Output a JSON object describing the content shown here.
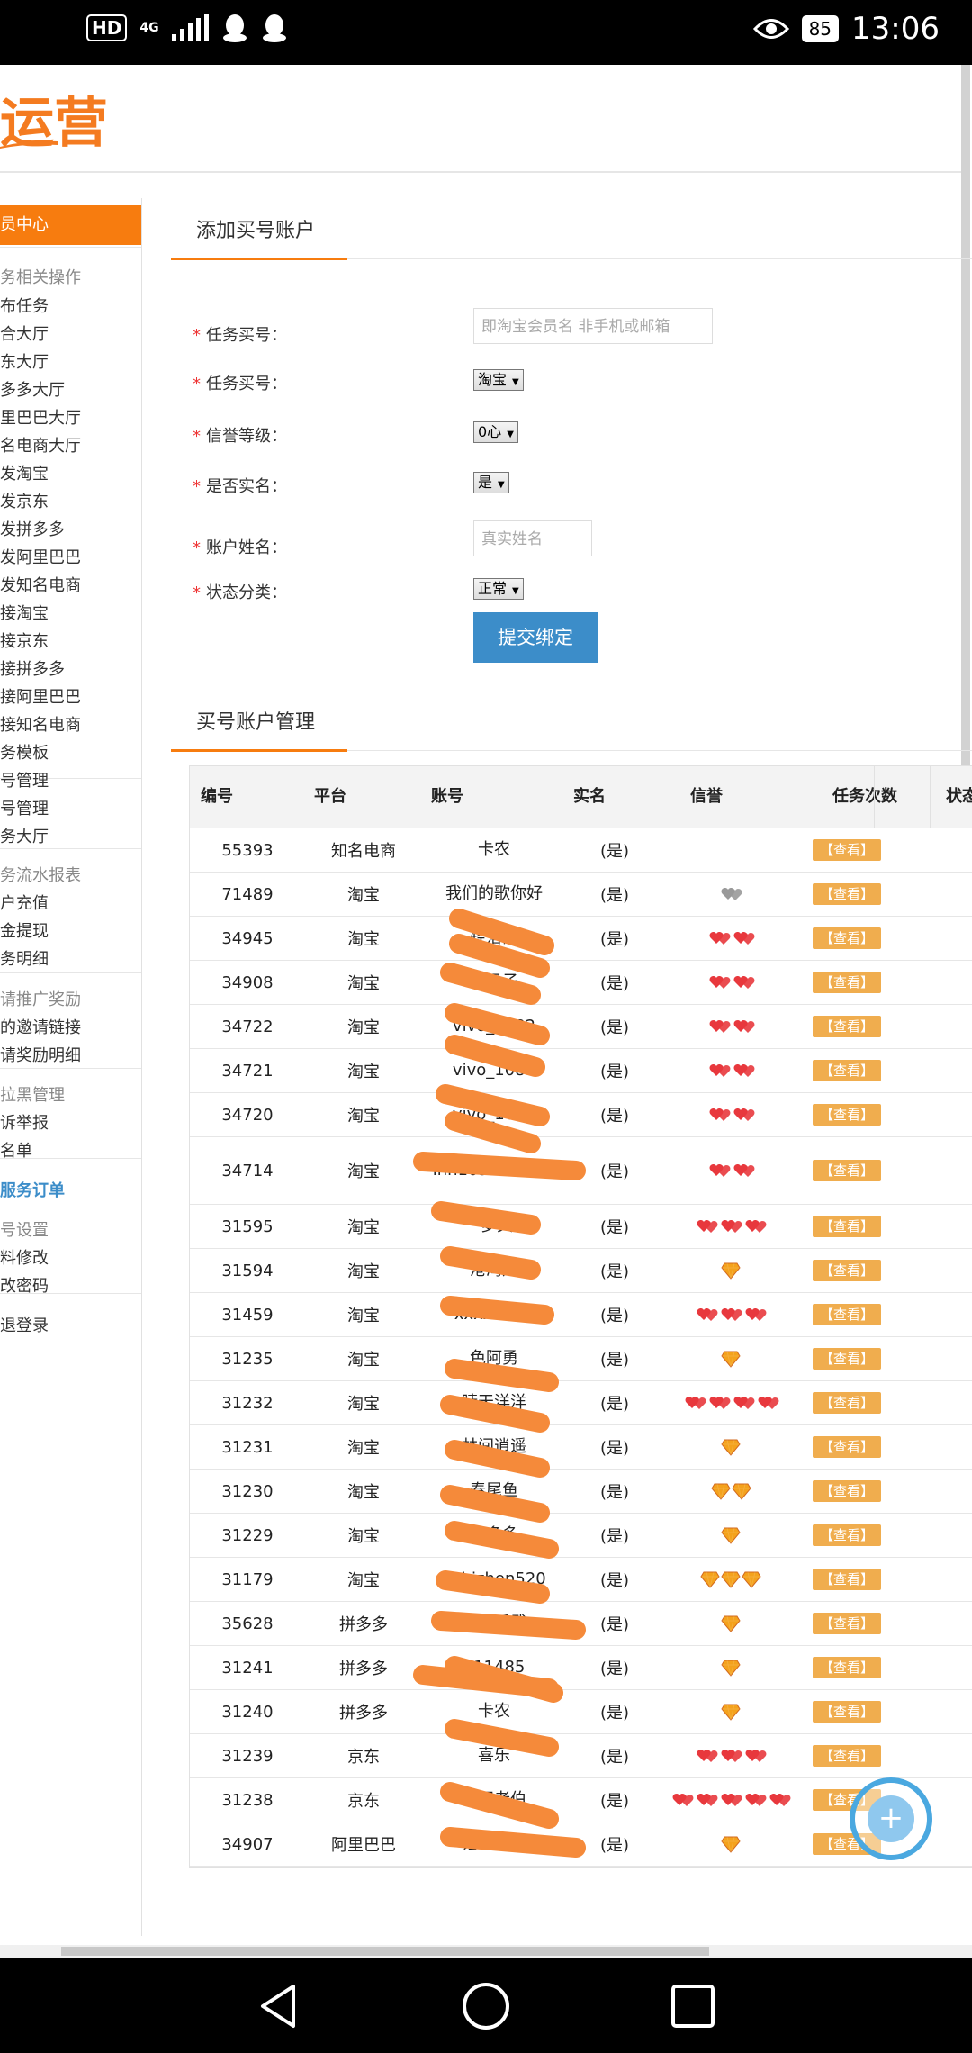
{
  "status_bar": {
    "hd": "HD",
    "network": "4G",
    "battery": "85",
    "time": "13:06"
  },
  "logo_text": "运营",
  "sidebar": {
    "active": "员中心",
    "sections": [
      {
        "type": "group",
        "label": "务相关操作"
      },
      {
        "type": "item",
        "label": "布任务"
      },
      {
        "type": "item",
        "label": "合大厅"
      },
      {
        "type": "item",
        "label": "东大厅"
      },
      {
        "type": "item",
        "label": "多多大厅"
      },
      {
        "type": "item",
        "label": "里巴巴大厅"
      },
      {
        "type": "item",
        "label": "名电商大厅"
      },
      {
        "type": "item",
        "label": "发淘宝"
      },
      {
        "type": "item",
        "label": "发京东"
      },
      {
        "type": "item",
        "label": "发拼多多"
      },
      {
        "type": "item",
        "label": "发阿里巴巴"
      },
      {
        "type": "item",
        "label": "发知名电商"
      },
      {
        "type": "item",
        "label": "接淘宝"
      },
      {
        "type": "item",
        "label": "接京东"
      },
      {
        "type": "item",
        "label": "接拼多多"
      },
      {
        "type": "item",
        "label": "接阿里巴巴"
      },
      {
        "type": "item",
        "label": "接知名电商"
      },
      {
        "type": "item",
        "label": "务模板"
      },
      {
        "type": "item",
        "label": "号管理"
      },
      {
        "type": "item",
        "label": "号管理"
      },
      {
        "type": "item",
        "label": "务大厅"
      },
      {
        "type": "group",
        "label": "务流水报表"
      },
      {
        "type": "item",
        "label": "户充值"
      },
      {
        "type": "item",
        "label": "金提现"
      },
      {
        "type": "item",
        "label": "务明细"
      },
      {
        "type": "group",
        "label": "请推广奖励"
      },
      {
        "type": "item",
        "label": "的邀请链接"
      },
      {
        "type": "item",
        "label": "请奖励明细"
      },
      {
        "type": "group",
        "label": "拉黑管理"
      },
      {
        "type": "item",
        "label": "诉举报"
      },
      {
        "type": "item",
        "label": "名单"
      },
      {
        "type": "link",
        "label": "服务订单"
      },
      {
        "type": "group",
        "label": "号设置"
      },
      {
        "type": "item",
        "label": "料修改"
      },
      {
        "type": "item",
        "label": "改密码"
      },
      {
        "type": "item",
        "label": "退登录"
      }
    ]
  },
  "form": {
    "title": "添加买号账户",
    "fields": [
      {
        "label": "任务买号：",
        "kind": "input",
        "placeholder": "即淘宝会员名 非手机或邮箱"
      },
      {
        "label": "任务买号：",
        "kind": "select",
        "value": "淘宝"
      },
      {
        "label": "信誉等级：",
        "kind": "select",
        "value": "0心"
      },
      {
        "label": "是否实名：",
        "kind": "select",
        "value": "是"
      },
      {
        "label": "账户姓名：",
        "kind": "input",
        "placeholder": "真实姓名"
      },
      {
        "label": "状态分类：",
        "kind": "select",
        "value": "正常"
      }
    ],
    "submit_label": "提交绑定"
  },
  "table": {
    "title": "买号账户管理",
    "columns": [
      "编号",
      "平台",
      "账号",
      "实名",
      "信誉",
      "任务次数",
      "状态"
    ],
    "view_label": "【查看】",
    "rows": [
      {
        "id": "55393",
        "platform": "知名电商",
        "account": "卡农",
        "realname": "(是)",
        "credit_type": "none",
        "credit_count": 0
      },
      {
        "id": "71489",
        "platform": "淘宝",
        "account": "我们的歌你好",
        "realname": "(是)",
        "credit_type": "grayheart",
        "credit_count": 1
      },
      {
        "id": "34945",
        "platform": "淘宝",
        "account": "轻落雨",
        "realname": "(是)",
        "credit_type": "heart",
        "credit_count": 2
      },
      {
        "id": "34908",
        "platform": "淘宝",
        "account": "旺风子",
        "realname": "(是)",
        "credit_type": "heart",
        "credit_count": 2
      },
      {
        "id": "34722",
        "platform": "淘宝",
        "account": "vivo_1082",
        "realname": "(是)",
        "credit_type": "heart",
        "credit_count": 2
      },
      {
        "id": "34721",
        "platform": "淘宝",
        "account": "vivo_1081",
        "realname": "(是)",
        "credit_type": "heart",
        "credit_count": 2
      },
      {
        "id": "34720",
        "platform": "淘宝",
        "account": "vivo_1080",
        "realname": "(是)",
        "credit_type": "heart",
        "credit_count": 2
      },
      {
        "id": "34714",
        "platform": "淘宝",
        "account": "lhh1095545 46",
        "realname": "(是)",
        "credit_type": "heart",
        "credit_count": 2
      },
      {
        "id": "31595",
        "platform": "淘宝",
        "account": "一梦文8",
        "realname": "(是)",
        "credit_type": "heart",
        "credit_count": 3
      },
      {
        "id": "31594",
        "platform": "淘宝",
        "account": "港湾风",
        "realname": "(是)",
        "credit_type": "gem",
        "credit_count": 1
      },
      {
        "id": "31459",
        "platform": "淘宝",
        "account": "xxxx0000",
        "realname": "(是)",
        "credit_type": "heart",
        "credit_count": 3
      },
      {
        "id": "31235",
        "platform": "淘宝",
        "account": "色阿勇",
        "realname": "(是)",
        "credit_type": "gem",
        "credit_count": 1
      },
      {
        "id": "31232",
        "platform": "淘宝",
        "account": "晴天洋洋",
        "realname": "(是)",
        "credit_type": "heart",
        "credit_count": 4
      },
      {
        "id": "31231",
        "platform": "淘宝",
        "account": "林间逍遥",
        "realname": "(是)",
        "credit_type": "gem",
        "credit_count": 1
      },
      {
        "id": "31230",
        "platform": "淘宝",
        "account": "春尾鱼",
        "realname": "(是)",
        "credit_type": "gem",
        "credit_count": 2
      },
      {
        "id": "31229",
        "platform": "淘宝",
        "account": "钱多多",
        "realname": "(是)",
        "credit_type": "gem",
        "credit_count": 1
      },
      {
        "id": "31179",
        "platform": "淘宝",
        "account": "liubizhen520",
        "realname": "(是)",
        "credit_type": "gem",
        "credit_count": 3
      },
      {
        "id": "35628",
        "platform": "拼多多",
        "account": "旺兴乐武",
        "realname": "(是)",
        "credit_type": "gem",
        "credit_count": 1
      },
      {
        "id": "31241",
        "platform": "拼多多",
        "account": "211485",
        "realname": "(是)",
        "credit_type": "gem",
        "credit_count": 1
      },
      {
        "id": "31240",
        "platform": "拼多多",
        "account": "卡农",
        "realname": "(是)",
        "credit_type": "gem",
        "credit_count": 1
      },
      {
        "id": "31239",
        "platform": "京东",
        "account": "喜乐",
        "realname": "(是)",
        "credit_type": "heart",
        "credit_count": 3
      },
      {
        "id": "31238",
        "platform": "京东",
        "account": "肥田老伯",
        "realname": "(是)",
        "credit_type": "heart",
        "credit_count": 5
      },
      {
        "id": "34907",
        "platform": "阿里巴巴",
        "account": "锤子小鱼",
        "realname": "(是)",
        "credit_type": "gem",
        "credit_count": 1
      }
    ]
  },
  "colors": {
    "accent": "#f77c0f",
    "primary_button": "#3c8dc9",
    "view_button": "#f0ad4e",
    "scribble": "#f58a3a"
  }
}
